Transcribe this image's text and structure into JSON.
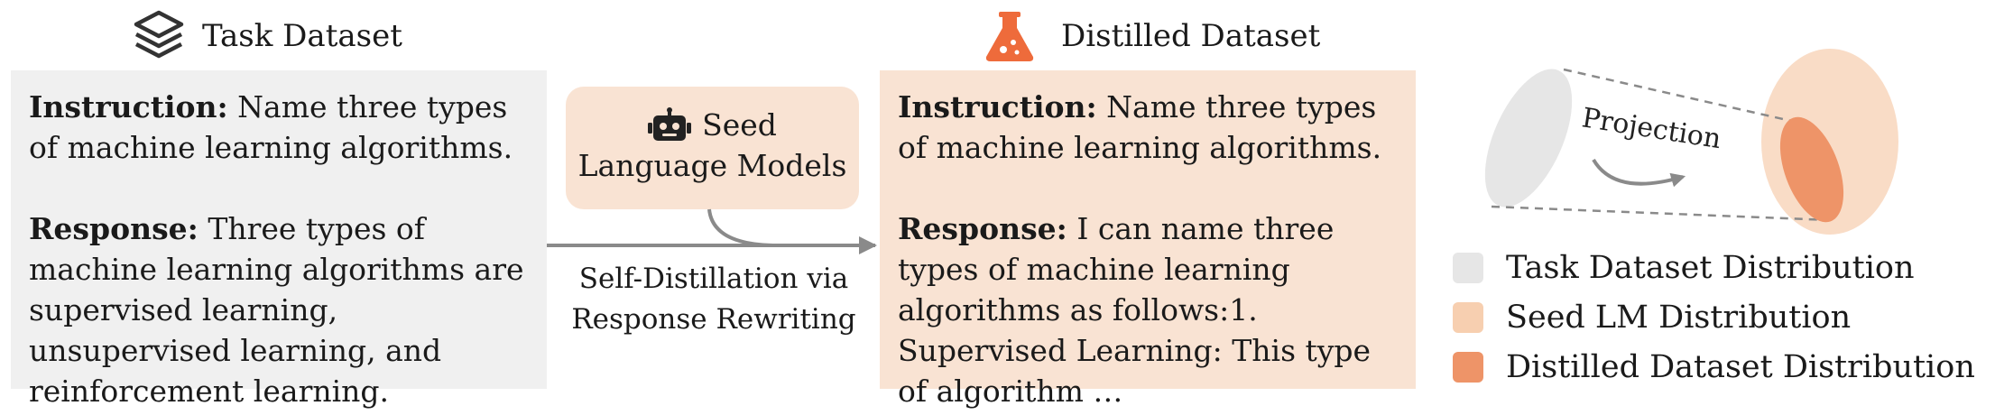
{
  "headers": {
    "task_dataset": "Task Dataset",
    "distilled_dataset": "Distilled Dataset"
  },
  "task_panel": {
    "instruction_label": "Instruction:",
    "instruction_text": " Name three types of machine learning algorithms.",
    "response_label": "Response:",
    "response_text": " Three types of machine learning algorithms are supervised learning, unsupervised learning, and reinforcement learning."
  },
  "distilled_panel": {
    "instruction_label": "Instruction:",
    "instruction_text": " Name three types of machine learning algorithms.",
    "response_label": "Response:",
    "response_text": " I can name three types of machine learning algorithms as follows:1. Supervised Learning: This type of algorithm …"
  },
  "seed_box": {
    "line1": "Seed",
    "line2": "Language Models"
  },
  "arrow_caption": {
    "line1": "Self-Distillation via",
    "line2": "Response Rewriting"
  },
  "projection_label": "Projection",
  "legend": [
    {
      "label": "Task Dataset Distribution",
      "color": "#e6e6e6"
    },
    {
      "label": "Seed LM Distribution",
      "color": "#f7cfb0"
    },
    {
      "label": "Distilled Dataset Distribution",
      "color": "#ee9468"
    }
  ],
  "colors": {
    "task_panel_bg": "#f0f0f0",
    "distilled_panel_bg": "#f9e3d3",
    "flask_icon": "#ee6b3b",
    "arrow": "#8a8a8a"
  }
}
